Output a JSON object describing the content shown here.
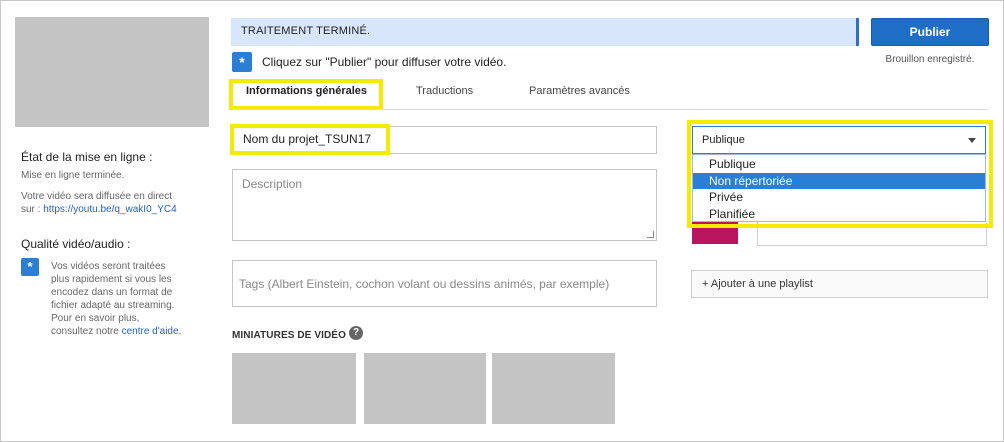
{
  "left_panel": {
    "upload_status_title": "État de la mise en ligne :",
    "upload_status_text": "Mise en ligne terminée.",
    "broadcast_text_1": "Votre vidéo sera diffusée en direct",
    "broadcast_text_2": "sur : ",
    "video_url": "https://youtu.be/q_wakI0_YC4",
    "quality_title": "Qualité vidéo/audio :",
    "quality_lines": [
      "Vos vidéos seront traitées",
      "plus rapidement si vous les",
      "encodez dans un format de",
      "fichier adapté au streaming.",
      "Pour en savoir plus,"
    ],
    "quality_last_prefix": "consultez notre ",
    "help_center_link": "centre d'aide",
    "quality_last_suffix": "."
  },
  "banner": {
    "status": "TRAITEMENT TERMINÉ.",
    "publish_label": "Publier",
    "draft_status": "Brouillon enregistré.",
    "hint": "Cliquez sur \"Publier\" pour diffuser votre vidéo."
  },
  "tabs": [
    {
      "label": "Informations générales",
      "active": true
    },
    {
      "label": "Traductions",
      "active": false
    },
    {
      "label": "Paramètres avancés",
      "active": false
    }
  ],
  "form": {
    "title_value": "Nom du projet_TSUN17",
    "description_placeholder": "Description",
    "tags_placeholder": "Tags (Albert Einstein, cochon volant ou dessins animés, par exemple)",
    "thumbnails_label": "MINIATURES DE VIDÉO",
    "help_glyph": "?"
  },
  "visibility": {
    "selected": "Publique",
    "options": [
      "Publique",
      "Non répertoriée",
      "Privée",
      "Planifiée"
    ],
    "highlighted_index": 1
  },
  "playlist": {
    "add_label": "+ Ajouter à une playlist"
  },
  "icons": {
    "info": "star-info-icon",
    "help": "question-circle-icon",
    "dropdown": "caret-down-icon"
  },
  "colors": {
    "accent": "#1d6ec4",
    "highlight": "#f3ec00",
    "banner_bg": "#d7e6fa",
    "selected_option": "#2a7fd4"
  }
}
